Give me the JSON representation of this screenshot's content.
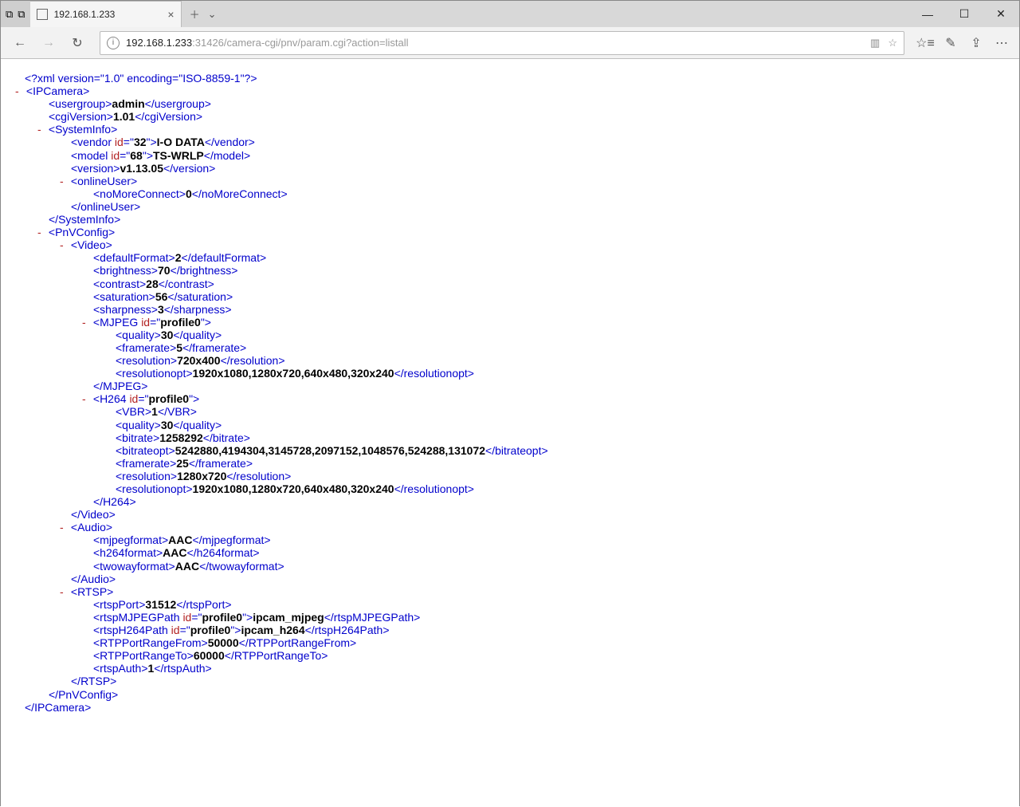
{
  "tab": {
    "title": "192.168.1.233"
  },
  "address": {
    "host": "192.168.1.233",
    "rest": ":31426/camera-cgi/pnv/param.cgi?action=listall"
  },
  "xml": {
    "declaration": "<?xml version=\"1.0\" encoding=\"ISO-8859-1\"?>",
    "root": "IPCamera",
    "usergroup": "admin",
    "cgiVersion": "1.01",
    "SystemInfo": {
      "vendor": {
        "id": "32",
        "value": "I-O DATA"
      },
      "model": {
        "id": "68",
        "value": "TS-WRLP"
      },
      "version": "v1.13.05",
      "onlineUser": {
        "noMoreConnect": "0"
      }
    },
    "PnVConfig": {
      "Video": {
        "defaultFormat": "2",
        "brightness": "70",
        "contrast": "28",
        "saturation": "56",
        "sharpness": "3",
        "MJPEG": {
          "id": "profile0",
          "quality": "30",
          "framerate": "5",
          "resolution": "720x400",
          "resolutionopt": "1920x1080,1280x720,640x480,320x240"
        },
        "H264": {
          "id": "profile0",
          "VBR": "1",
          "quality": "30",
          "bitrate": "1258292",
          "bitrateopt": "5242880,4194304,3145728,2097152,1048576,524288,131072",
          "framerate": "25",
          "resolution": "1280x720",
          "resolutionopt": "1920x1080,1280x720,640x480,320x240"
        }
      },
      "Audio": {
        "mjpegformat": "AAC",
        "h264format": "AAC",
        "twowayformat": "AAC"
      },
      "RTSP": {
        "rtspPort": "31512",
        "rtspMJPEGPath": {
          "id": "profile0",
          "value": "ipcam_mjpeg"
        },
        "rtspH264Path": {
          "id": "profile0",
          "value": "ipcam_h264"
        },
        "RTPPortRangeFrom": "50000",
        "RTPPortRangeTo": "60000",
        "rtspAuth": "1"
      }
    }
  }
}
